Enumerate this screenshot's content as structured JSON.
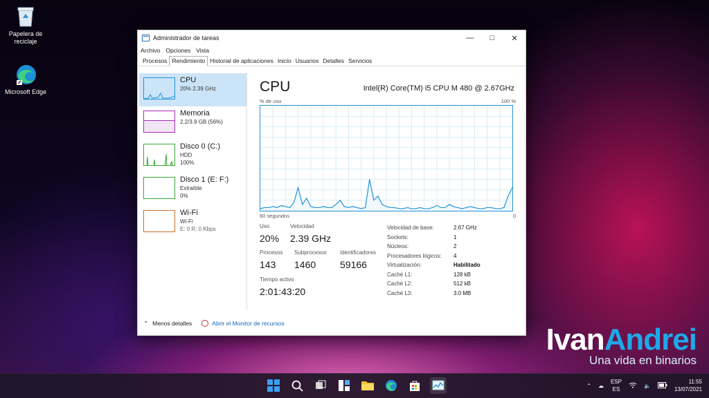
{
  "desktop": {
    "icons": [
      {
        "label": "Papelera de reciclaje",
        "icon": "recycle-bin-icon"
      },
      {
        "label": "Microsoft Edge",
        "icon": "edge-icon"
      }
    ],
    "brand_main_1": "Ivan",
    "brand_main_2": "Andrei",
    "brand_sub": "Una vida en binarios"
  },
  "window": {
    "title": "Administrador de tareas",
    "menu": [
      "Archivo",
      "Opciones",
      "Vista"
    ],
    "tabs": [
      "Procesos",
      "Rendimiento",
      "Historial de aplicaciones",
      "Inicio",
      "Usuarios",
      "Detalles",
      "Servicios"
    ],
    "active_tab": "Rendimiento"
  },
  "sidebar": [
    {
      "name": "CPU",
      "line1": "20% 2.39 GHz",
      "line2": "",
      "color": "#1f93d6"
    },
    {
      "name": "Memoria",
      "line1": "2.2/3.9 GB (56%)",
      "line2": "",
      "color": "#a52ab8"
    },
    {
      "name": "Disco 0 (C:)",
      "line1": "HDD",
      "line2": "100%",
      "color": "#3aa637"
    },
    {
      "name": "Disco 1 (E: F:)",
      "line1": "Extraíble",
      "line2": "0%",
      "color": "#3aa637"
    },
    {
      "name": "Wi-Fi",
      "line1": "Wi-Fi",
      "line2": "E: 0 R: 0 Kbps",
      "color": "#c8702c"
    }
  ],
  "cpu": {
    "title": "CPU",
    "model": "Intel(R) Core(TM) i5 CPU M 480 @ 2.67GHz",
    "graph_label_left": "% de uso",
    "graph_label_right": "100 %",
    "graph_time_left": "60 segundos",
    "graph_time_right": "0",
    "usage_history": [
      2,
      3,
      3,
      4,
      3,
      5,
      4,
      3,
      8,
      22,
      6,
      12,
      4,
      3,
      3,
      4,
      3,
      3,
      6,
      10,
      4,
      3,
      4,
      3,
      2,
      3,
      30,
      10,
      14,
      6,
      4,
      3,
      3,
      2,
      2,
      3,
      2,
      2,
      3,
      2,
      2,
      3,
      5,
      3,
      3,
      6,
      4,
      3,
      2,
      3,
      4,
      3,
      2,
      2,
      3,
      3,
      2,
      2,
      3,
      14,
      22
    ],
    "usage_label": "Uso",
    "usage_value": "20%",
    "speed_label": "Velocidad",
    "speed_value": "2.39 GHz",
    "processes_label": "Procesos",
    "processes_value": "143",
    "threads_label": "Subprocesos",
    "threads_value": "1460",
    "handles_label": "Identificadores",
    "handles_value": "59166",
    "uptime_label": "Tiempo activo",
    "uptime_value": "2:01:43:20",
    "specs": [
      {
        "k": "Velocidad de base:",
        "v": "2.67 GHz"
      },
      {
        "k": "Sockets:",
        "v": "1"
      },
      {
        "k": "Núcleos:",
        "v": "2"
      },
      {
        "k": "Procesadores lógicos:",
        "v": "4"
      },
      {
        "k": "Virtualización:",
        "v": "Habilitado"
      },
      {
        "k": "Caché L1:",
        "v": "128 kB"
      },
      {
        "k": "Caché L2:",
        "v": "512 kB"
      },
      {
        "k": "Caché L3:",
        "v": "3.0 MB"
      }
    ]
  },
  "footer": {
    "less_details": "Menos detalles",
    "resource_monitor": "Abrir el Monitor de recursos"
  },
  "taskbar": {
    "lang_top": "ESP",
    "lang_bottom": "ES",
    "time": "11:55",
    "date": "13/07/2021"
  }
}
